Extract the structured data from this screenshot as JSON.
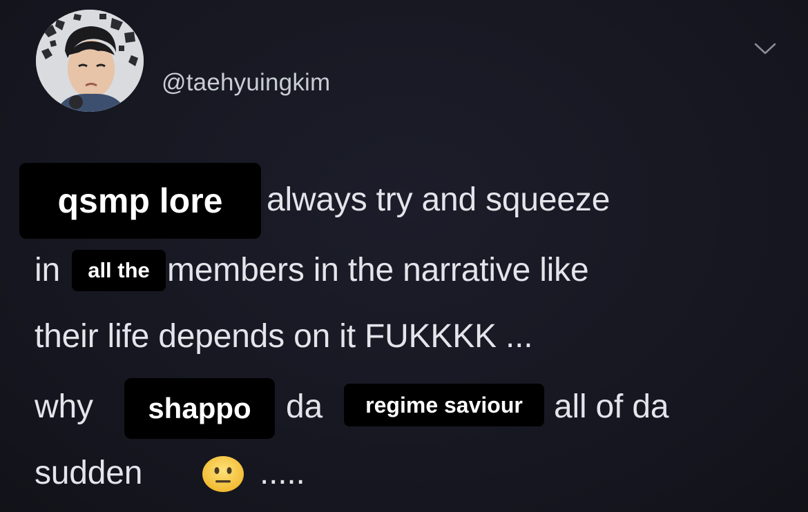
{
  "tweet": {
    "handle": "@taehyuingkim",
    "text_segments": {
      "l1_after": "always try and squeeze",
      "l2_before": "in",
      "l2_after": "members in the narrative like",
      "l3": "their life depends on it FUKKKK ...",
      "l4_before": "why",
      "l4_mid": "da",
      "l4_after": "all of da",
      "l5_before": "sudden",
      "l5_after": "....."
    },
    "emoji": "neutral-face-emoji"
  },
  "stickers": {
    "qsmp_lore": "qsmp lore",
    "all_the": "all the",
    "shappo": "shappo",
    "regime_saviour": "regime saviour"
  },
  "colors": {
    "background": "#161723",
    "text": "#e3e5ea",
    "handle": "#c9cdd4",
    "sticker_bg": "#000000",
    "sticker_text": "#ffffff"
  }
}
